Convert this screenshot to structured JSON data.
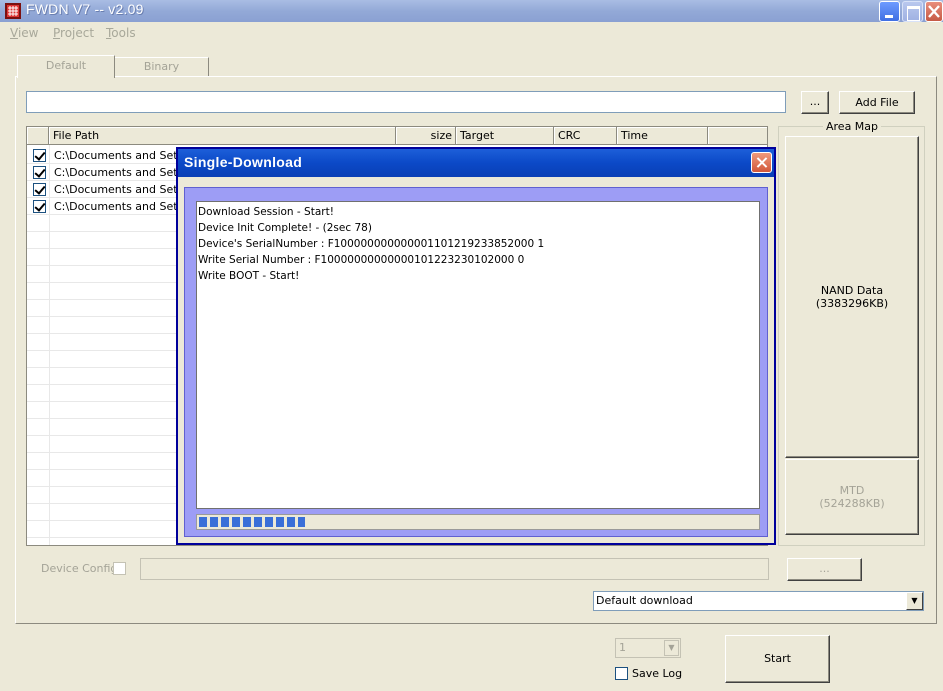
{
  "window": {
    "title": "FWDN V7 -- v2.09",
    "colors": {
      "titlebar": "#93a9d7",
      "dialog_title": "#0b49c7",
      "progress": "#3a6fd8"
    }
  },
  "menu": [
    {
      "label": "View"
    },
    {
      "label": "Project"
    },
    {
      "label": "Tools"
    }
  ],
  "tabs": [
    {
      "label": "Default",
      "active": true
    },
    {
      "label": "Binary",
      "active": false
    }
  ],
  "path_row": {
    "value": "",
    "browse_label": "...",
    "add_file_label": "Add File"
  },
  "file_list": {
    "columns": [
      "File Path",
      "size",
      "Target",
      "CRC",
      "Time"
    ],
    "rows": [
      {
        "checked": true,
        "path": "C:\\Documents and Setti"
      },
      {
        "checked": true,
        "path": "C:\\Documents and Setti"
      },
      {
        "checked": true,
        "path": "C:\\Documents and Setti"
      },
      {
        "checked": true,
        "path": "C:\\Documents and Setti"
      }
    ]
  },
  "area_map": {
    "title": "Area Map",
    "nand": {
      "name": "NAND Data",
      "size": "(3383296KB)"
    },
    "mtd": {
      "name": "MTD",
      "size": "(524288KB)"
    }
  },
  "device_config": {
    "label": "Device Config",
    "value": "",
    "button_label": "..."
  },
  "download_mode": {
    "selected": "Default download"
  },
  "count": {
    "selected": "1"
  },
  "save_log": {
    "label": "Save Log",
    "checked": false
  },
  "start": {
    "label": "Start"
  },
  "dialog": {
    "title": "Single-Download",
    "log": [
      "Download Session - Start!",
      "Device Init Complete! - (2sec 78)",
      "Device's SerialNumber : F100000000000001101219233852000 1",
      "Write Serial Number : F10000000000000101223230102000 0",
      "Write BOOT - Start!"
    ],
    "progress": 0.19
  }
}
